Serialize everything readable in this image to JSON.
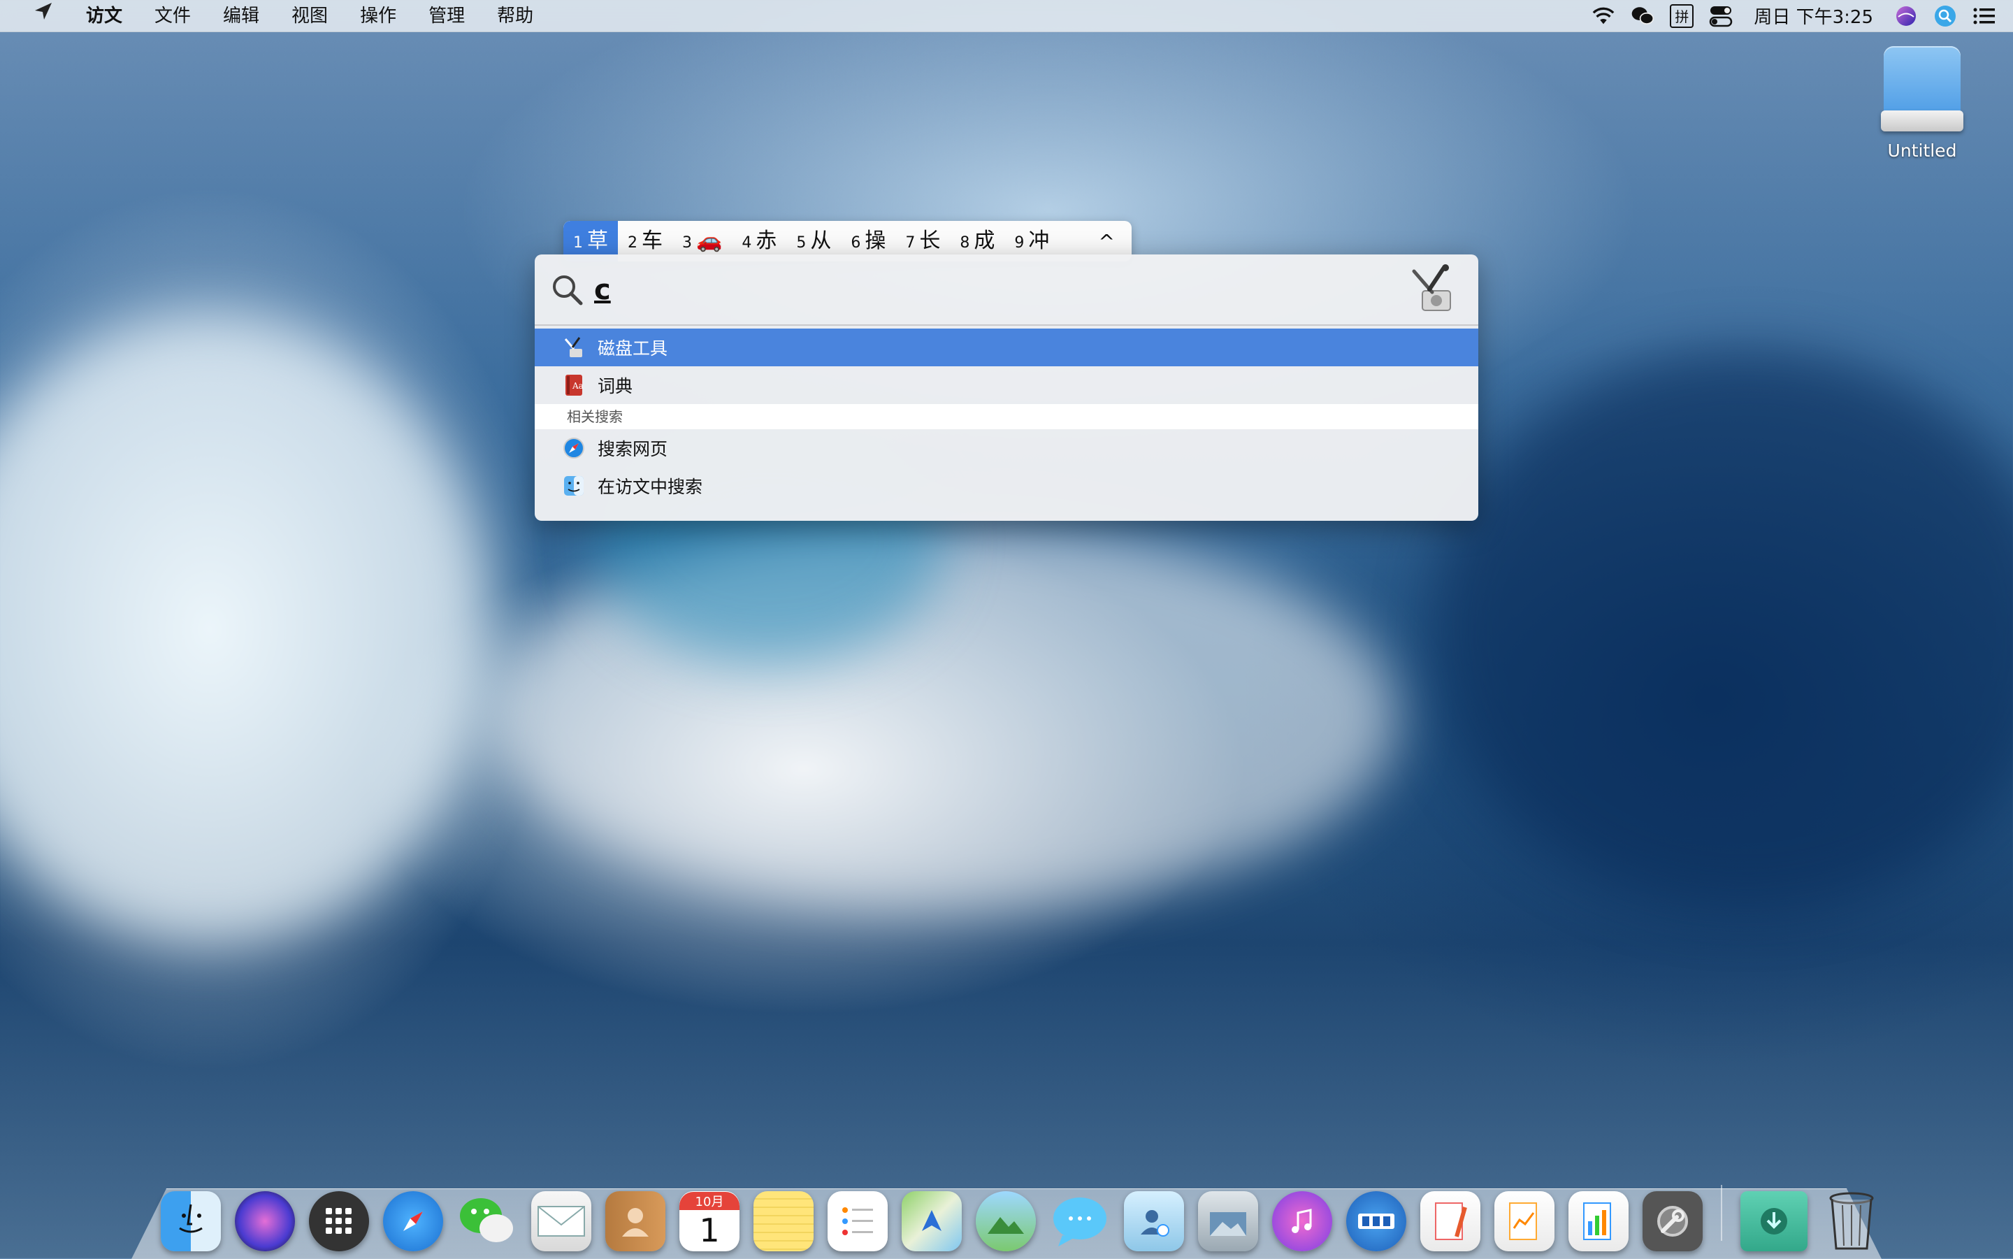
{
  "menubar": {
    "app_name": "访文",
    "menus": [
      "文件",
      "编辑",
      "视图",
      "操作",
      "管理",
      "帮助"
    ],
    "input_method_label": "拼",
    "clock": "周日 下午3:25",
    "icons": [
      "location-arrow-icon",
      "wifi-icon",
      "wechat-icon",
      "input-method-icon",
      "control-center-icon",
      "siri-icon",
      "spotlight-icon",
      "notification-list-icon"
    ]
  },
  "desktop": {
    "drive_label": "Untitled"
  },
  "ime": {
    "candidates": [
      {
        "num": "1",
        "text": "草"
      },
      {
        "num": "2",
        "text": "车"
      },
      {
        "num": "3",
        "text": "🚗"
      },
      {
        "num": "4",
        "text": "赤"
      },
      {
        "num": "5",
        "text": "从"
      },
      {
        "num": "6",
        "text": "操"
      },
      {
        "num": "7",
        "text": "长"
      },
      {
        "num": "8",
        "text": "成"
      },
      {
        "num": "9",
        "text": "冲"
      }
    ],
    "selected_index": 0,
    "collapse_glyph": "^"
  },
  "spotlight": {
    "query": "c",
    "results": [
      {
        "label": "磁盘工具",
        "icon": "disk-utility-icon",
        "selected": true
      },
      {
        "label": "词典",
        "icon": "dictionary-icon",
        "selected": false
      }
    ],
    "section_header": "相关搜索",
    "related": [
      {
        "label": "搜索网页",
        "icon": "safari-icon"
      },
      {
        "label": "在访文中搜索",
        "icon": "finder-icon"
      }
    ]
  },
  "dock": {
    "apps": [
      "finder",
      "siri",
      "launchpad",
      "safari",
      "wechat",
      "mail",
      "contacts",
      "calendar",
      "notes",
      "reminders",
      "maps",
      "photos",
      "messages",
      "facetime",
      "image-capture",
      "itunes",
      "keynote-style",
      "pages",
      "keynote",
      "numbers",
      "system-preferences",
      "downloads",
      "trash"
    ],
    "calendar_month": "10月",
    "calendar_day": "1"
  },
  "colors": {
    "selection_blue": "#4a84dd",
    "ime_selected": "#3f7fe0"
  }
}
